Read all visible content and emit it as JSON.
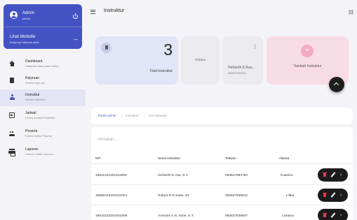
{
  "admin": {
    "name": "Admin",
    "role": "admin",
    "website_title": "Lihat Website",
    "website_sub": "Kunjungi halaman awal"
  },
  "sidebar": {
    "items": [
      {
        "label": "Dashboard",
        "sub": "Halaman awal panel admin",
        "icon": "home-icon",
        "active": false
      },
      {
        "label": "Kejuruan",
        "sub": "Kelola Kejuruan",
        "icon": "book-icon",
        "active": false
      },
      {
        "label": "Instruktur",
        "sub": "Kelola Instruktur",
        "icon": "person-icon",
        "active": true
      },
      {
        "label": "Jadwal",
        "sub": "Kelola Jadwal Pelatihan",
        "icon": "calendar-icon",
        "active": false
      },
      {
        "label": "Peserta",
        "sub": "Kelola Daftar Peserta",
        "icon": "group-icon",
        "active": false
      },
      {
        "label": "Laporan",
        "sub": "Lihat & Cetak Laporan",
        "icon": "printer-icon",
        "active": false
      }
    ]
  },
  "header": {
    "title": "Instruktur"
  },
  "stats": {
    "total_count": "3",
    "total_label": "Total Instruktur",
    "latest_badge": "Terbaru",
    "latest_name": "Herberth E Asa...",
    "latest_phone": "083647894783",
    "add_label": "Tambah Instruktur"
  },
  "breadcrumb": {
    "items": [
      "Panel Admin",
      "Instruktur",
      "List Instruktur"
    ],
    "separator": "/"
  },
  "search": {
    "placeholder": "Temukan..."
  },
  "table": {
    "columns": [
      "NIP",
      "Nama Instruktur",
      "Telepon",
      "Alamat"
    ],
    "rows": [
      {
        "nip": "19811221201011006",
        "nama": "Herberth E Asa, S.T.",
        "telepon": "083647894783",
        "alamat": "Kuanino"
      },
      {
        "nip": "19860416201011004",
        "nama": "Robert R.D Kase, ST.",
        "telepon": "082537536542",
        "alamat": "Liliba"
      },
      {
        "nip": "19810223201001009",
        "nama": "Amrotus A.N. Adoe, S.T.",
        "telepon": "082637538947",
        "alamat": "Lasiana"
      }
    ]
  },
  "colors": {
    "accent": "#4453c3",
    "pink": "#f8dce5",
    "lavender": "#e2e4f7",
    "danger": "#e63a4f"
  }
}
